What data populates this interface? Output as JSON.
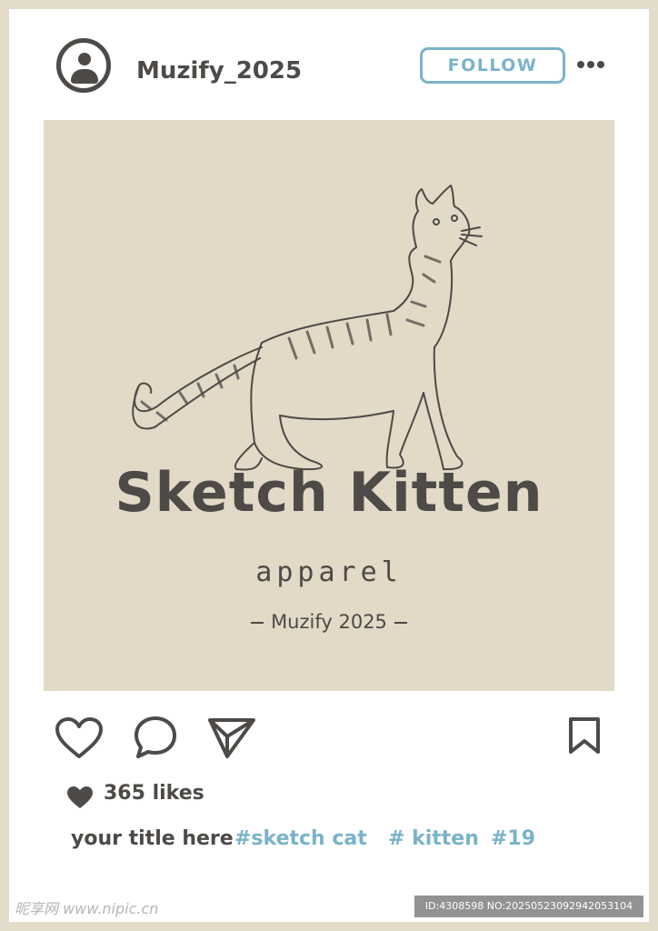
{
  "header": {
    "username": "Muzify_2025",
    "follow_label": "FOLLOW"
  },
  "post": {
    "brand_title": "Sketch Kitten",
    "brand_subtitle": "apparel",
    "brand_credit": "Muzify 2025"
  },
  "actions": {
    "like_icon": "heart-outline-icon",
    "comment_icon": "speech-bubble-icon",
    "share_icon": "paper-plane-icon",
    "save_icon": "bookmark-icon"
  },
  "likes": {
    "label": "365 likes"
  },
  "caption": {
    "title": "your title here",
    "tags": [
      "#sketch cat",
      "# kitten",
      "#19"
    ]
  },
  "watermark": {
    "site": "昵享网 www.nipic.cn",
    "id_text": "ID:4308598 NO:20250523092942053104"
  },
  "colors": {
    "frame": "#e3dccb",
    "image_bg": "#e2d9c6",
    "text_dark": "#4d4a47",
    "accent_blue": "#7ab3c9"
  }
}
